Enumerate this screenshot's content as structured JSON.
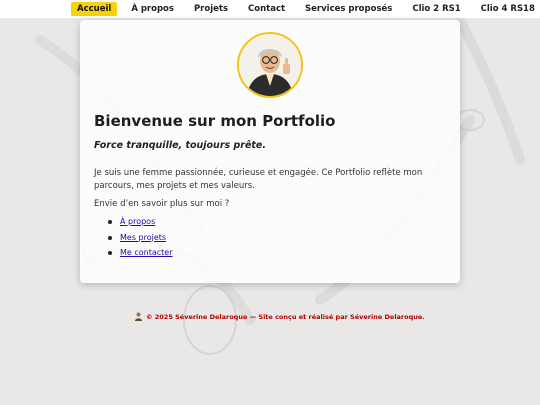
{
  "nav": {
    "items": [
      {
        "label": "Accueil",
        "active": true
      },
      {
        "label": "À propos",
        "active": false
      },
      {
        "label": "Projets",
        "active": false
      },
      {
        "label": "Contact",
        "active": false
      },
      {
        "label": "Services proposés",
        "active": false
      },
      {
        "label": "Clio 2 RS1",
        "active": false
      },
      {
        "label": "Clio 4 RS18",
        "active": false
      }
    ]
  },
  "main": {
    "title": "Bienvenue sur mon Portfolio",
    "tagline": "Force tranquille, toujours prête.",
    "intro": "Je suis une femme passionnée, curieuse et engagée. Ce Portfolio reflète mon parcours, mes projets et mes valeurs.",
    "question": "Envie d’en savoir plus sur moi ?",
    "links": [
      "À propos",
      "Mes projets",
      "Me contacter"
    ]
  },
  "footer": {
    "text": "© 2025 Séverine Delaroque — Site conçu et réalisé par Séverine Delaroque."
  },
  "colors": {
    "accent": "#f5d20a",
    "link": "#1a0dab",
    "footer_text": "#b00000",
    "background": "#e9e8e6"
  },
  "icons": {
    "avatar": "cartoon-woman-thumbs-up-avatar",
    "footer": "small-figure-icon"
  }
}
